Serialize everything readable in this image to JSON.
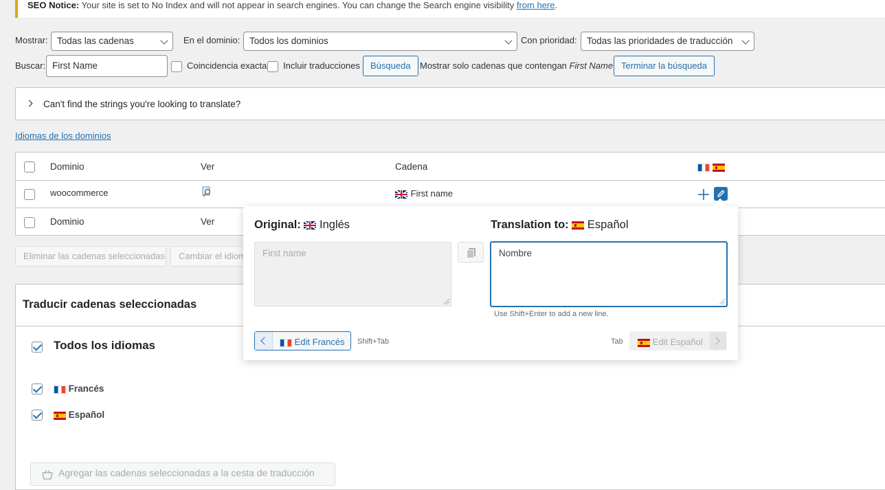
{
  "notice": {
    "bold": "SEO Notice:",
    "text": " Your site is set to No Index and will not appear in search engines. You can change the Search engine visibility ",
    "link": "from here",
    "end": "."
  },
  "filters": {
    "show_label": "Mostrar:",
    "show_value": "Todas las cadenas",
    "domain_label": "En el dominio:",
    "domain_value": "Todos los dominios",
    "priority_label": "Con prioridad:",
    "priority_value": "Todas las prioridades de traducción",
    "search_label": "Buscar:",
    "search_value": "First Name",
    "exact_label": "Coincidencia exacta",
    "include_label": "Incluir traducciones",
    "search_button": "Búsqueda",
    "showing_prefix": "Mostrar solo cadenas que contengan ",
    "showing_term": "First Name",
    "end_search_button": "Terminar la búsqueda"
  },
  "cant_find": "Can't find the strings you're looking to translate?",
  "domain_languages_link": "Idiomas de los dominios",
  "table": {
    "headers": {
      "domain": "Dominio",
      "view": "Ver",
      "string": "Cadena"
    },
    "rows": [
      {
        "domain": "woocommerce",
        "string": "First name"
      }
    ],
    "footer": {
      "domain": "Dominio",
      "view": "Ver"
    }
  },
  "bulk": {
    "delete_button": "Eliminar las cadenas seleccionadas",
    "change_language_button": "Cambiar el idioma"
  },
  "translate_panel": {
    "title": "Traducir cadenas seleccionadas",
    "all_languages": "Todos los idiomas",
    "languages": [
      "Francés",
      "Español"
    ],
    "add_basket_button": "Agregar las cadenas seleccionadas a la cesta de traducción"
  },
  "popup": {
    "original_label": "Original:",
    "original_lang": "Inglés",
    "translation_label": "Translation to:",
    "translation_lang": "Español",
    "original_text": "First name",
    "translation_text": "Nombre",
    "hint": "Use Shift+Enter to add a new line.",
    "prev_button": "Edit Francés",
    "prev_shortcut": "Shift+Tab",
    "next_shortcut": "Tab",
    "next_button": "Edit Español"
  },
  "colors": {
    "accent": "#2271b1",
    "notice_border": "#dba617",
    "background": "#f0f0f1"
  }
}
